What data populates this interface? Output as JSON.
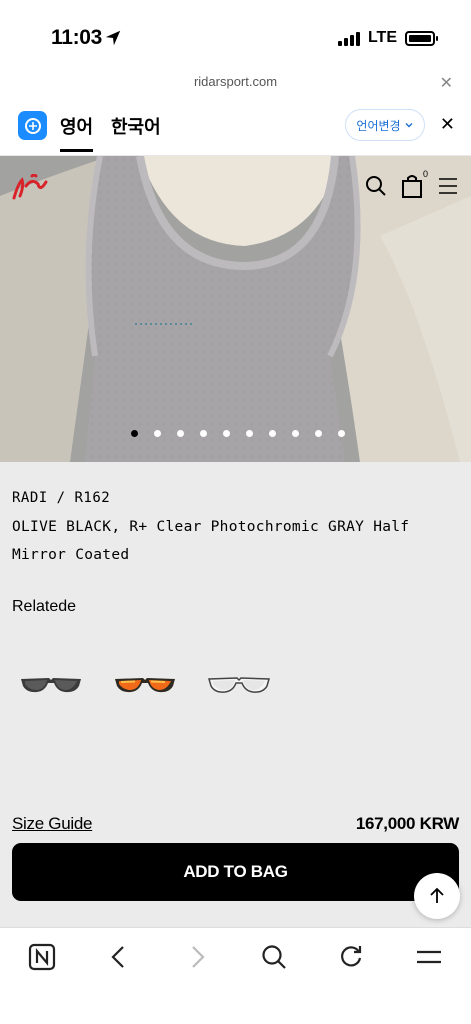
{
  "status_bar": {
    "time": "11:03",
    "network": "LTE"
  },
  "browser": {
    "url": "ridarsport.com"
  },
  "translate_bar": {
    "tab_active": "영어",
    "tab_other": "한국어",
    "change_language": "언어변경",
    "close_icon": "close-icon"
  },
  "header": {
    "cart_count": "0",
    "icons": [
      "search-icon",
      "bag-icon",
      "menu-icon"
    ]
  },
  "carousel": {
    "total": 10,
    "active_index": 0
  },
  "product": {
    "brand": "RADI / R162",
    "name": "OLIVE BLACK, R+ Clear Photochromic GRAY Half Mirror Coated",
    "related_label": "Relatede",
    "related_items": [
      "black-frame-sunglasses",
      "orange-mirror-sunglasses",
      "clear-frame-sunglasses"
    ],
    "size_guide": "Size Guide",
    "price": "167,000 KRW",
    "add_to_bag": "ADD TO BAG"
  },
  "toolbar": {
    "icons": [
      "naver-icon",
      "back-icon",
      "forward-icon",
      "search-icon",
      "refresh-icon",
      "menu-icon"
    ]
  },
  "colors": {
    "accent": "#1a8cff",
    "brand_red": "#d8232a"
  }
}
